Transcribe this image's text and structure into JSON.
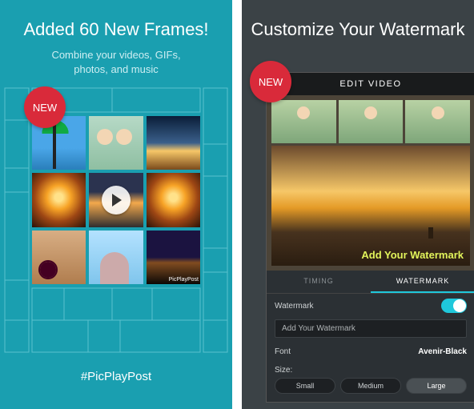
{
  "left": {
    "title": "Added 60 New Frames!",
    "subtitle_l1": "Combine your videos, GIFs,",
    "subtitle_l2": "photos, and music",
    "badge": "NEW",
    "hashtag": "#PicPlayPost",
    "tile_brand": "PicPlayPost"
  },
  "right": {
    "title": "Customize Your Watermark",
    "badge": "NEW",
    "editor_header": "EDIT VIDEO",
    "watermark_text": "Add Your Watermark",
    "tabs": {
      "timing": "TIMING",
      "watermark": "WATERMARK"
    },
    "row_watermark_label": "Watermark",
    "input_value": "Add Your Watermark",
    "row_font_label": "Font",
    "font_value": "Avenir-Black",
    "row_size_label": "Size:",
    "sizes": {
      "small": "Small",
      "medium": "Medium",
      "large": "Large"
    }
  }
}
